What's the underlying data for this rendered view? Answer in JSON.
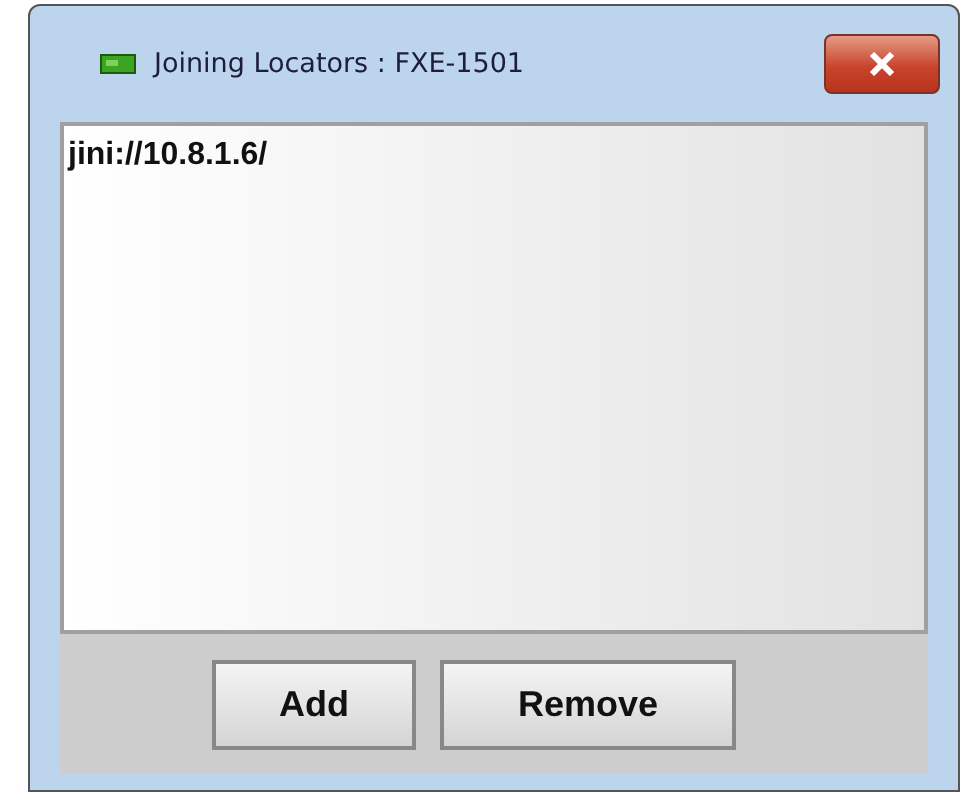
{
  "window": {
    "title": "Joining Locators : FXE-1501"
  },
  "locators": [
    {
      "text": "jini://10.8.1.6/",
      "selected": false
    }
  ],
  "buttons": [
    "Add",
    "Remove"
  ]
}
